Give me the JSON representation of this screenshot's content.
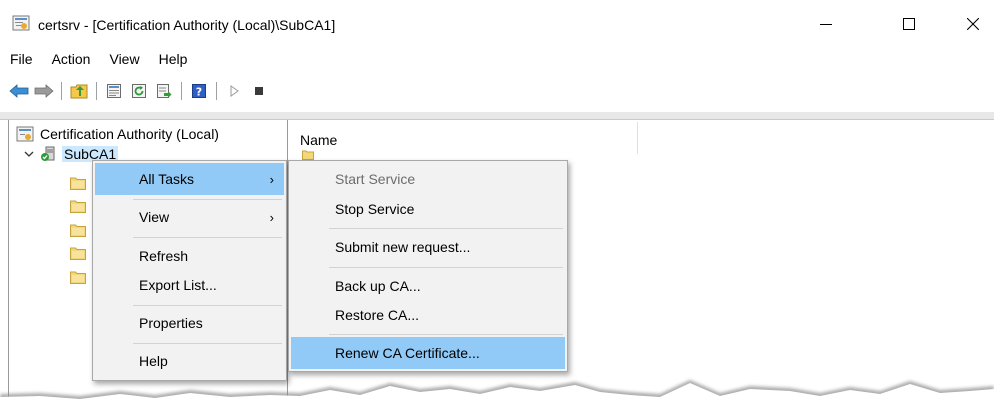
{
  "window": {
    "title": "certsrv - [Certification Authority (Local)\\SubCA1]"
  },
  "menubar": {
    "items": [
      "File",
      "Action",
      "View",
      "Help"
    ]
  },
  "toolbar": {
    "buttons": [
      "back-arrow-icon",
      "forward-arrow-icon",
      "up-folder-icon",
      "properties-icon",
      "refresh-icon",
      "export-list-icon",
      "help-icon",
      "start-service-icon",
      "stop-service-icon"
    ]
  },
  "tree": {
    "root_label": "Certification Authority (Local)",
    "selected_label": "SubCA1"
  },
  "list": {
    "column_name": "Name"
  },
  "context_menu": {
    "all_tasks": "All Tasks",
    "view": "View",
    "refresh": "Refresh",
    "export_list": "Export List...",
    "properties": "Properties",
    "help": "Help"
  },
  "submenu": {
    "start_service": "Start Service",
    "stop_service": "Stop Service",
    "submit_new_request": "Submit new request...",
    "back_up_ca": "Back up CA...",
    "restore_ca": "Restore CA...",
    "renew_ca_certificate": "Renew CA Certificate..."
  },
  "colors": {
    "highlight": "#91c9f7",
    "selection": "#cce8ff",
    "menu_bg": "#f2f2f2"
  }
}
